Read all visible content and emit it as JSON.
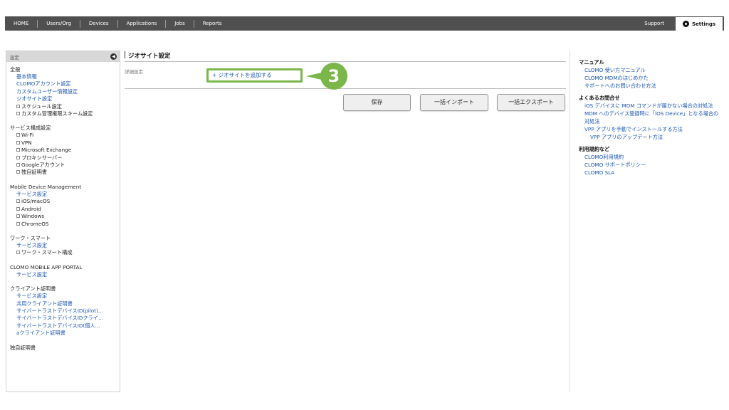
{
  "nav": {
    "items": [
      "HOME",
      "Users/Org",
      "Devices",
      "Applications",
      "Jobs",
      "Reports"
    ],
    "support": "Support",
    "settings": "Settings"
  },
  "sidebar": {
    "header": "設定",
    "sections": [
      {
        "title": "全般",
        "items": [
          {
            "type": "link",
            "label": "基本情報"
          },
          {
            "type": "link",
            "label": "CLOMOアカウント設定"
          },
          {
            "type": "link",
            "label": "カスタムユーザー情報設定"
          },
          {
            "type": "link",
            "label": "ジオサイト設定"
          },
          {
            "type": "tree",
            "label": "スケジュール設定"
          },
          {
            "type": "tree",
            "label": "カスタム管理権限スキーム設定"
          }
        ]
      },
      {
        "title": "サービス構成設定",
        "items": [
          {
            "type": "tree",
            "label": "Wi-Fi"
          },
          {
            "type": "tree",
            "label": "VPN"
          },
          {
            "type": "tree",
            "label": "Microsoft Exchange"
          },
          {
            "type": "tree",
            "label": "プロキシサーバー"
          },
          {
            "type": "tree",
            "label": "Googleアカウント"
          },
          {
            "type": "tree",
            "label": "独自証明書"
          }
        ]
      },
      {
        "title": "Mobile Device Management",
        "items": [
          {
            "type": "link",
            "label": "サービス設定"
          },
          {
            "type": "tree",
            "label": "iOS/macOS"
          },
          {
            "type": "tree",
            "label": "Android"
          },
          {
            "type": "tree",
            "label": "Windows"
          },
          {
            "type": "tree",
            "label": "ChromeOS"
          }
        ]
      },
      {
        "title": "ワーク・スマート",
        "items": [
          {
            "type": "link",
            "label": "サービス設定"
          },
          {
            "type": "tree",
            "label": "ワーク・スマート構成"
          }
        ]
      },
      {
        "title": "CLOMO MOBILE APP PORTAL",
        "items": [
          {
            "type": "link",
            "label": "サービス設定"
          }
        ]
      },
      {
        "title": "クライアント証明書",
        "items": [
          {
            "type": "link",
            "label": "サービス設定"
          },
          {
            "type": "link",
            "label": "共用クライアント証明書"
          },
          {
            "type": "link",
            "label": "サイバートラストデバイスID(pilot)…"
          },
          {
            "type": "link",
            "label": "サイバートラストデバイスIDクライ…"
          },
          {
            "type": "link",
            "label": "サイバートラストデバイスID(個人…"
          },
          {
            "type": "link",
            "label": "aクライアント証明書"
          }
        ]
      },
      {
        "title": "独自証明書",
        "items": []
      }
    ]
  },
  "main": {
    "title": "ジオサイト設定",
    "detail_label": "詳細設定",
    "add_link": "+ ジオサイトを追加する",
    "step": "3",
    "buttons": {
      "save": "保存",
      "import": "一括インポート",
      "export": "一括エクスポート"
    }
  },
  "right": {
    "groups": [
      {
        "title": "マニュアル",
        "links": [
          {
            "label": "CLOMO 使い方マニュアル"
          },
          {
            "label": "CLOMO MDMのはじめかた"
          },
          {
            "label": "サポートへのお問い合わせ方法"
          }
        ]
      },
      {
        "title": "よくあるお問合せ",
        "links": [
          {
            "label": "iOS デバイスに MDM コマンドが届かない場合の対処法"
          },
          {
            "label": "MDM へのデバイス登録時に「iOS Device」となる場合の対処法"
          },
          {
            "label": "VPP アプリを手動でインストールする方法"
          },
          {
            "label": "VPP アプリのアップデート方法",
            "sub": true
          }
        ]
      },
      {
        "title": "利用規約など",
        "links": [
          {
            "label": "CLOMO利用規約"
          },
          {
            "label": "CLOMO サポートポリシー"
          },
          {
            "label": "CLOMO SLA"
          }
        ]
      }
    ]
  }
}
